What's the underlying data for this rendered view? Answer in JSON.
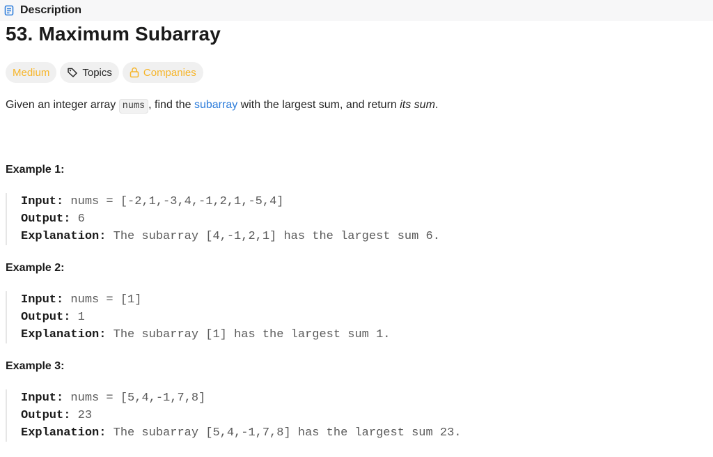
{
  "tab": {
    "label": "Description",
    "icon": "document-icon"
  },
  "problem": {
    "title": "53. Maximum Subarray",
    "difficulty": "Medium",
    "topics_label": "Topics",
    "companies_label": "Companies"
  },
  "description": {
    "part1": "Given an integer array ",
    "code": "nums",
    "part2": ", find the ",
    "link": "subarray",
    "part3": " with the largest sum, and return ",
    "emphasis": "its sum",
    "part4": "."
  },
  "labels": {
    "input": "Input:",
    "output": "Output:",
    "explanation": "Explanation:"
  },
  "examples": [
    {
      "title": "Example 1:",
      "input": "nums = [-2,1,-3,4,-1,2,1,-5,4]",
      "output": "6",
      "explanation": "The subarray [4,-1,2,1] has the largest sum 6."
    },
    {
      "title": "Example 2:",
      "input": "nums = [1]",
      "output": "1",
      "explanation": "The subarray [1] has the largest sum 1."
    },
    {
      "title": "Example 3:",
      "input": "nums = [5,4,-1,7,8]",
      "output": "23",
      "explanation": "The subarray [5,4,-1,7,8] has the largest sum 23."
    }
  ],
  "colors": {
    "difficulty": "#f6b52a",
    "link": "#2d7ddb"
  }
}
